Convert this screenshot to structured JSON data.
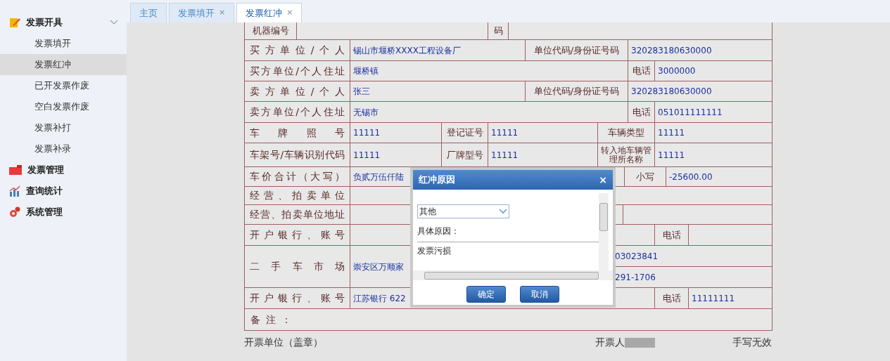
{
  "sidebar": {
    "groups": [
      {
        "label": "发票开具",
        "kind": "pencil",
        "expanded": true,
        "children": [
          {
            "label": "发票填开",
            "selected": false
          },
          {
            "label": "发票红冲",
            "selected": true
          },
          {
            "label": "已开发票作废",
            "selected": false
          },
          {
            "label": "空白发票作废",
            "selected": false
          },
          {
            "label": "发票补打",
            "selected": false
          },
          {
            "label": "发票补录",
            "selected": false
          }
        ]
      },
      {
        "label": "发票管理",
        "kind": "folder",
        "expanded": false
      },
      {
        "label": "查询统计",
        "kind": "chart",
        "expanded": false
      },
      {
        "label": "系统管理",
        "kind": "gears",
        "expanded": false
      }
    ]
  },
  "tabs": [
    {
      "label": "主页",
      "closable": false,
      "selected": false
    },
    {
      "label": "发票填开",
      "closable": true,
      "selected": false
    },
    {
      "label": "发票红冲",
      "closable": true,
      "selected": true
    }
  ],
  "close_glyph": "×",
  "invoice_form": {
    "rows": [
      {
        "cells": [
          {
            "kind": "label",
            "text": "机器编号"
          },
          {
            "kind": "value"
          },
          {
            "kind": "label",
            "text": "码"
          },
          {
            "kind": "value"
          }
        ]
      },
      {
        "cells": [
          {
            "kind": "label",
            "text": "买方单位/个人"
          },
          {
            "kind": "value",
            "text": "锡山市堰桥XXXX工程设备厂"
          },
          {
            "kind": "label",
            "text": "单位代码/身份证号码"
          },
          {
            "kind": "value",
            "text": "320283180630000"
          }
        ]
      },
      {
        "cells": [
          {
            "kind": "label",
            "text": "买方单位/个人住址"
          },
          {
            "kind": "value",
            "text": "堰桥镇"
          },
          {
            "kind": "label",
            "text": "电话"
          },
          {
            "kind": "value",
            "text": "3000000"
          }
        ]
      },
      {
        "cells": [
          {
            "kind": "label",
            "text": "卖方单位/个人"
          },
          {
            "kind": "value",
            "text": "张三"
          },
          {
            "kind": "label",
            "text": "单位代码/身份证号码"
          },
          {
            "kind": "value",
            "text": "320283180630000"
          }
        ]
      },
      {
        "cells": [
          {
            "kind": "label",
            "text": "卖方单位/个人住址"
          },
          {
            "kind": "value",
            "text": "无锡市"
          },
          {
            "kind": "label",
            "text": "电话"
          },
          {
            "kind": "value",
            "text": "051011111111"
          }
        ]
      },
      {
        "cells": [
          {
            "kind": "label",
            "text": "车牌照号"
          },
          {
            "kind": "value",
            "text": "11111"
          },
          {
            "kind": "label",
            "text": "登记证号"
          },
          {
            "kind": "value",
            "text": "11111"
          },
          {
            "kind": "label",
            "text": "车辆类型"
          },
          {
            "kind": "value",
            "text": "11111"
          }
        ]
      },
      {
        "cells": [
          {
            "kind": "label",
            "text": "车架号/车辆识别代码"
          },
          {
            "kind": "value",
            "text": "11111"
          },
          {
            "kind": "label",
            "text": "厂牌型号"
          },
          {
            "kind": "value",
            "text": "11111"
          },
          {
            "kind": "label",
            "text": "转入地车辆管理所名称"
          },
          {
            "kind": "value",
            "text": "11111"
          }
        ]
      },
      {
        "cells": [
          {
            "kind": "label",
            "text": "车价合计（大写）"
          },
          {
            "kind": "value",
            "text": "负贰万伍仟陆"
          },
          {
            "kind": "label",
            "text": "小写"
          },
          {
            "kind": "value",
            "text": "-25600.00"
          }
        ]
      },
      {
        "cells": [
          {
            "kind": "label",
            "text": "经营、拍卖单位"
          },
          {
            "kind": "value"
          }
        ]
      },
      {
        "cells": [
          {
            "kind": "label",
            "text": "经营、拍卖单位地址"
          },
          {
            "kind": "value"
          },
          {
            "kind": "value"
          }
        ]
      },
      {
        "cells": [
          {
            "kind": "label",
            "text": "开户银行、账号"
          },
          {
            "kind": "value"
          },
          {
            "kind": "label",
            "text": "电话"
          },
          {
            "kind": "value"
          }
        ]
      },
      {
        "cells": [
          {
            "kind": "label",
            "text": "二手车市场"
          },
          {
            "kind": "value",
            "text": "崇安区万顺家"
          },
          {
            "kind": "stack",
            "lines": [
              "03023841",
              "291-1706"
            ]
          }
        ]
      },
      {
        "cells": [
          {
            "kind": "label",
            "text": "开户银行、账号"
          },
          {
            "kind": "value",
            "text": "江苏银行 622"
          },
          {
            "kind": "label",
            "text": "电话"
          },
          {
            "kind": "value",
            "text": "11111111"
          }
        ]
      },
      {
        "cells": [
          {
            "kind": "note",
            "text": "备注："
          }
        ]
      }
    ]
  },
  "footer": {
    "left": "开票单位（盖章）",
    "issuer_label": "开票人",
    "right": "手写无效"
  },
  "dialog": {
    "title": "红冲原因",
    "close": "×",
    "select_value": "其他",
    "reason_label": "具体原因：",
    "reason_value": "发票污损",
    "buttons": [
      "确定",
      "取消"
    ]
  }
}
